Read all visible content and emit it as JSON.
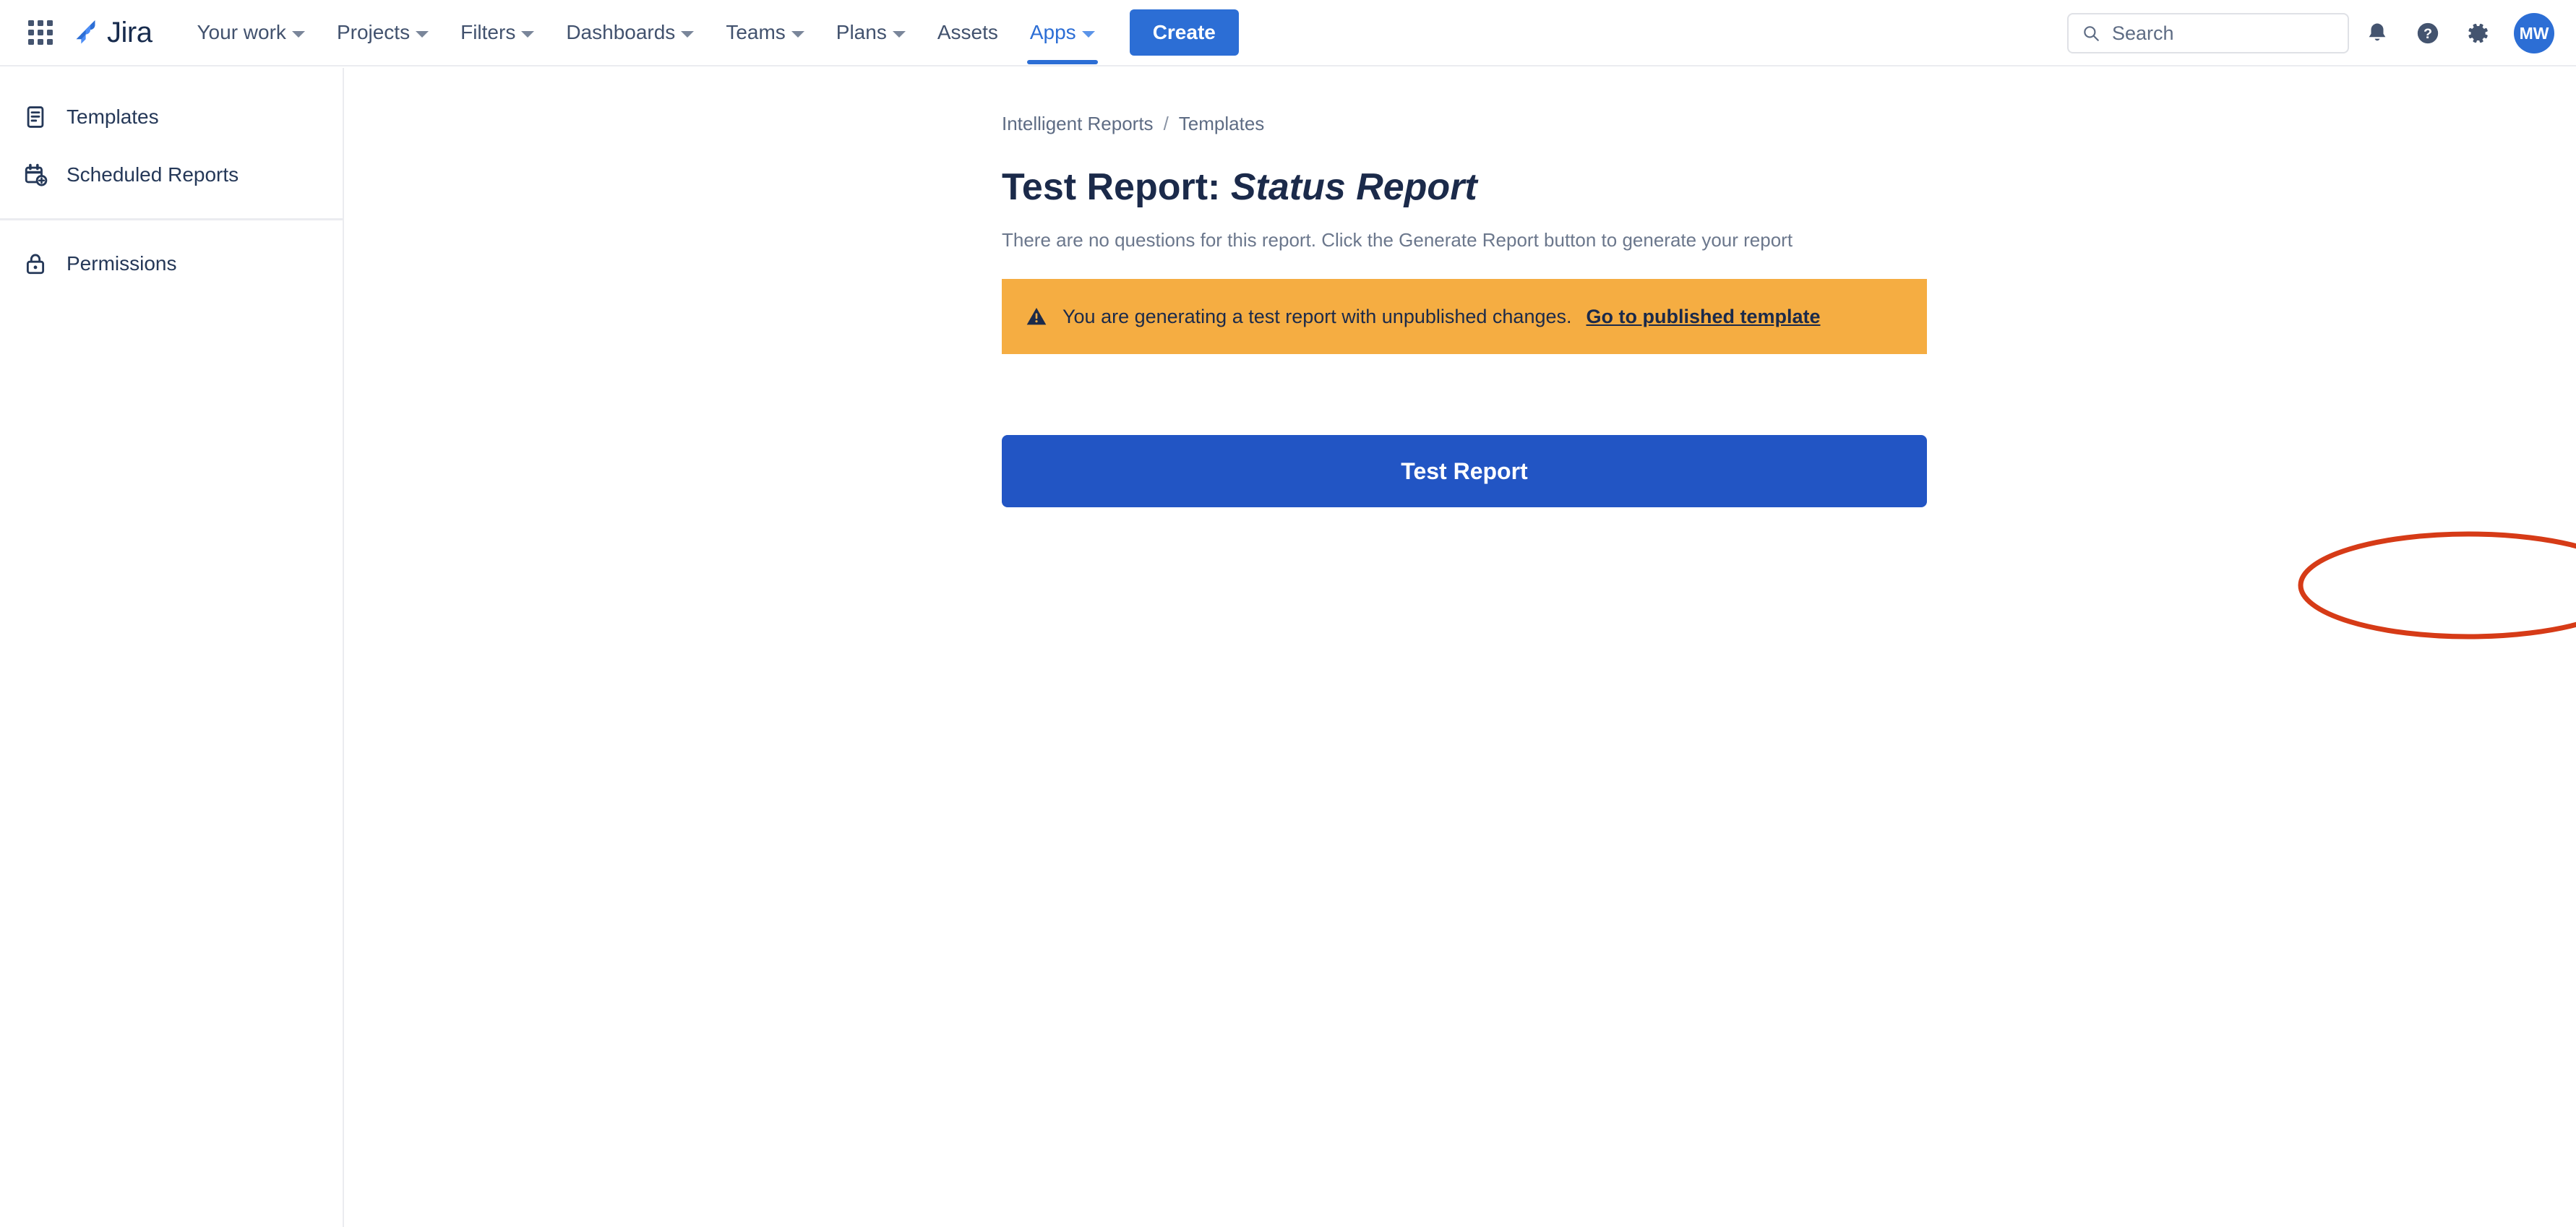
{
  "topnav": {
    "app_switcher_icon": "grid-apps-icon",
    "product_name": "Jira",
    "items": [
      {
        "label": "Your work",
        "has_chevron": true,
        "active": false
      },
      {
        "label": "Projects",
        "has_chevron": true,
        "active": false
      },
      {
        "label": "Filters",
        "has_chevron": true,
        "active": false
      },
      {
        "label": "Dashboards",
        "has_chevron": true,
        "active": false
      },
      {
        "label": "Teams",
        "has_chevron": true,
        "active": false
      },
      {
        "label": "Plans",
        "has_chevron": true,
        "active": false
      },
      {
        "label": "Assets",
        "has_chevron": false,
        "active": false
      },
      {
        "label": "Apps",
        "has_chevron": true,
        "active": true
      }
    ],
    "create_label": "Create",
    "search": {
      "placeholder": "Search",
      "value": "",
      "icon": "search-icon"
    },
    "notifications_icon": "bell-icon",
    "help_icon": "question-circle-icon",
    "settings_icon": "gear-icon",
    "avatar_initials": "MW"
  },
  "sidebar": {
    "items": [
      {
        "label": "Templates",
        "icon": "document-icon"
      },
      {
        "label": "Scheduled Reports",
        "icon": "calendar-plus-icon"
      },
      {
        "label": "Permissions",
        "icon": "lock-icon"
      }
    ]
  },
  "main": {
    "breadcrumb": {
      "root": "Intelligent Reports",
      "separator": "/",
      "current": "Templates"
    },
    "title_prefix": "Test Report: ",
    "title_emphasis": "Status Report",
    "subtitle": "There are no questions for this report. Click the Generate Report button to generate your report",
    "banner": {
      "icon": "warning-triangle-icon",
      "text": "You are generating a test report with unpublished changes.",
      "link_label": "Go to published template"
    },
    "primary_button_label": "Test Report"
  },
  "annotation": {
    "shape": "ellipse",
    "target": "test-report-button"
  },
  "colors": {
    "brand_blue": "#2c6ed5",
    "button_blue": "#2255c4",
    "warning_orange": "#f5ad42",
    "text_dark": "#1b2a4a",
    "text_muted": "#6b778c",
    "annotation_red": "#d63b17"
  }
}
